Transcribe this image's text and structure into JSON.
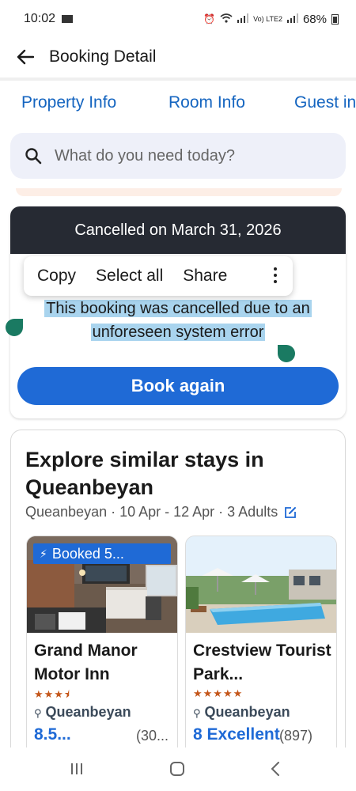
{
  "status_bar": {
    "time": "10:02",
    "network": "Vo) LTE2",
    "battery": "68%"
  },
  "app_bar": {
    "title": "Booking Detail"
  },
  "tabs": [
    {
      "label": "Property Info"
    },
    {
      "label": "Room Info"
    },
    {
      "label": "Guest in"
    }
  ],
  "search": {
    "placeholder": "What do you need today?"
  },
  "cancellation": {
    "header": "Cancelled on March 31, 2026",
    "message_line1": "This booking was cancelled due to an",
    "message_line2": "unforeseen system error",
    "book_again_label": "Book again"
  },
  "context_menu": {
    "items": [
      "Copy",
      "Select all",
      "Share"
    ]
  },
  "explore": {
    "title": "Explore similar stays in Queanbeyan",
    "subtitle": "Queanbeyan · 10 Apr - 12 Apr · 3 Adults",
    "hotels": [
      {
        "badge": "Booked 5...",
        "name": "Grand Manor Motor Inn",
        "stars": 3.5,
        "stars_text": "★★★⯨",
        "location": "Queanbeyan",
        "score": "8.5...",
        "reviews": "(30..."
      },
      {
        "name": "Crestview Tourist Park...",
        "stars": 5,
        "stars_text": "★★★★★",
        "location": "Queanbeyan",
        "score": "8 Excellent",
        "reviews": "(897)"
      }
    ]
  },
  "colors": {
    "accent": "#1f6ad6",
    "tab_link": "#1565c0",
    "cancel_header_bg": "#262a33",
    "selection": "#a9d4ee",
    "selection_handle": "#1a7a62",
    "star": "#c4561a"
  }
}
